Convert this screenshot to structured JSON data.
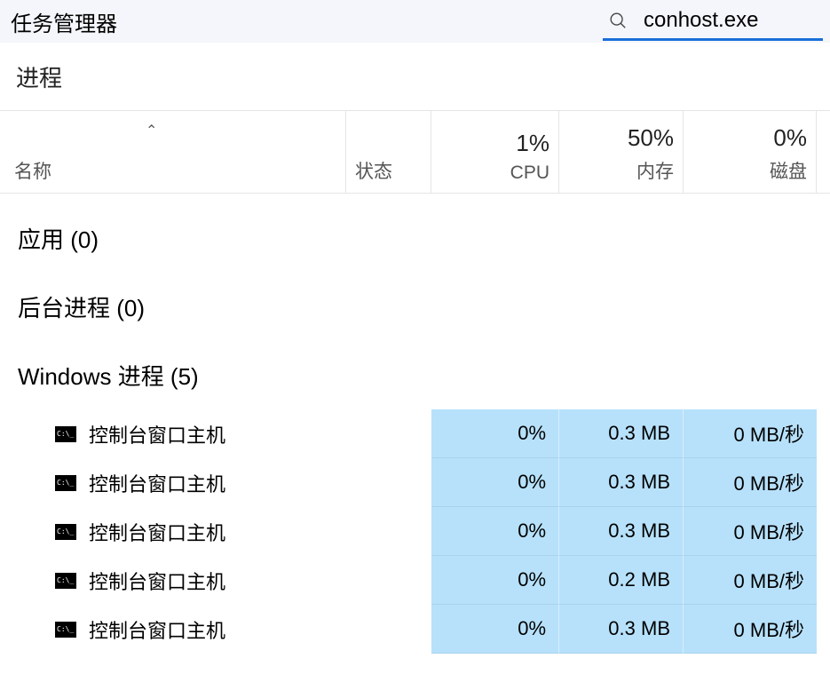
{
  "titlebar": {
    "title": "任务管理器",
    "search_value": "conhost.exe"
  },
  "tab": {
    "active_label": "进程"
  },
  "columns": {
    "name": "名称",
    "status": "状态",
    "cpu_pct": "1%",
    "cpu_label": "CPU",
    "mem_pct": "50%",
    "mem_label": "内存",
    "disk_pct": "0%",
    "disk_label": "磁盘"
  },
  "groups": {
    "apps": "应用 (0)",
    "background": "后台进程 (0)",
    "windows": "Windows 进程 (5)"
  },
  "processes": [
    {
      "name": "控制台窗口主机",
      "cpu": "0%",
      "mem": "0.3 MB",
      "disk": "0 MB/秒"
    },
    {
      "name": "控制台窗口主机",
      "cpu": "0%",
      "mem": "0.3 MB",
      "disk": "0 MB/秒"
    },
    {
      "name": "控制台窗口主机",
      "cpu": "0%",
      "mem": "0.3 MB",
      "disk": "0 MB/秒"
    },
    {
      "name": "控制台窗口主机",
      "cpu": "0%",
      "mem": "0.2 MB",
      "disk": "0 MB/秒"
    },
    {
      "name": "控制台窗口主机",
      "cpu": "0%",
      "mem": "0.3 MB",
      "disk": "0 MB/秒"
    }
  ]
}
